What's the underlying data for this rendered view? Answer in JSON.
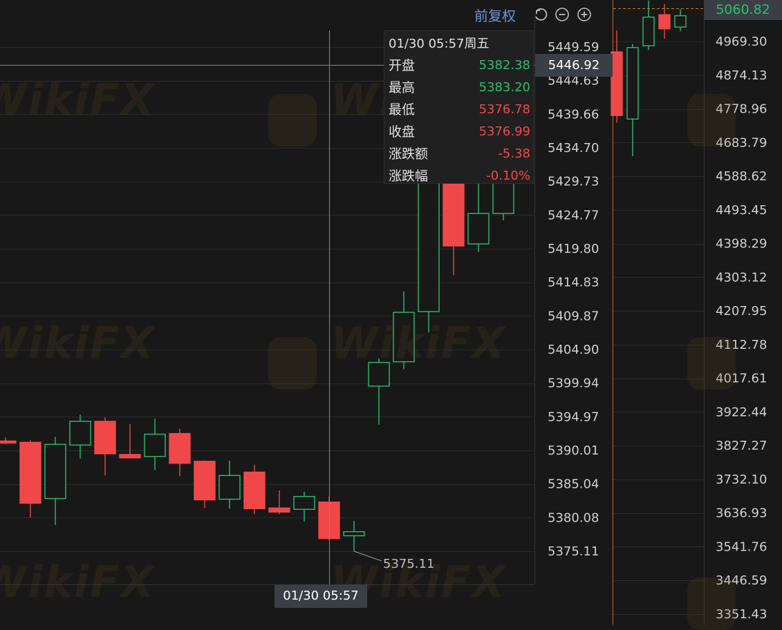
{
  "toolbar": {
    "adjust_label": "前复权",
    "icons": [
      "undo-icon",
      "zoom-out-icon",
      "zoom-in-icon"
    ]
  },
  "watermark": {
    "text": "WikiFX"
  },
  "colors": {
    "up": "#2dbd6e",
    "down": "#f04848",
    "background": "#181818",
    "grid": "#2a2a2a",
    "axis_text": "#d0d0d0"
  },
  "tooltip": {
    "date": "01/30 05:57周五",
    "rows": [
      {
        "key": "开盘",
        "value": "5382.38",
        "tone": "green"
      },
      {
        "key": "最高",
        "value": "5383.20",
        "tone": "green"
      },
      {
        "key": "最低",
        "value": "5376.78",
        "tone": "red"
      },
      {
        "key": "收盘",
        "value": "5376.99",
        "tone": "red"
      },
      {
        "key": "涨跌额",
        "value": "-5.38",
        "tone": "red"
      },
      {
        "key": "涨跌幅",
        "value": "-0.10%",
        "tone": "red"
      }
    ]
  },
  "crosshair": {
    "price_label": "5446.92",
    "time_label": "01/30 05:57"
  },
  "min_label": "5375.11",
  "right_panel": {
    "last_price": "5060.82"
  },
  "chart_data": [
    {
      "type": "candlestick",
      "title": "",
      "xlabel": "",
      "ylabel": "",
      "ylim": [
        5372.0,
        5458.0
      ],
      "y_ticks": [
        "5449.59",
        "5444.63",
        "5439.66",
        "5434.70",
        "5429.73",
        "5424.77",
        "5419.80",
        "5414.83",
        "5409.87",
        "5404.90",
        "5399.94",
        "5394.97",
        "5390.01",
        "5385.04",
        "5380.08",
        "5375.11"
      ],
      "grid": true,
      "candles": [
        {
          "o": 5391.4,
          "h": 5391.9,
          "l": 5390.9,
          "c": 5391.2
        },
        {
          "o": 5391.2,
          "h": 5391.5,
          "l": 5380.1,
          "c": 5382.2
        },
        {
          "o": 5382.9,
          "h": 5392.0,
          "l": 5379.0,
          "c": 5390.9
        },
        {
          "o": 5390.8,
          "h": 5395.3,
          "l": 5388.8,
          "c": 5394.3
        },
        {
          "o": 5394.3,
          "h": 5394.9,
          "l": 5386.3,
          "c": 5389.5
        },
        {
          "o": 5389.4,
          "h": 5393.9,
          "l": 5389.0,
          "c": 5388.9
        },
        {
          "o": 5389.1,
          "h": 5394.7,
          "l": 5387.1,
          "c": 5392.4
        },
        {
          "o": 5392.5,
          "h": 5393.2,
          "l": 5386.2,
          "c": 5388.1
        },
        {
          "o": 5388.4,
          "h": 5388.5,
          "l": 5381.5,
          "c": 5382.7
        },
        {
          "o": 5382.8,
          "h": 5388.5,
          "l": 5381.4,
          "c": 5386.3
        },
        {
          "o": 5386.8,
          "h": 5387.9,
          "l": 5380.6,
          "c": 5381.4
        },
        {
          "o": 5381.5,
          "h": 5384.1,
          "l": 5380.6,
          "c": 5380.9
        },
        {
          "o": 5381.3,
          "h": 5383.9,
          "l": 5379.5,
          "c": 5383.2
        },
        {
          "o": 5382.38,
          "h": 5383.2,
          "l": 5376.78,
          "c": 5376.99
        },
        {
          "o": 5377.4,
          "h": 5379.6,
          "l": 5375.11,
          "c": 5378.0
        },
        {
          "o": 5399.5,
          "h": 5403.6,
          "l": 5393.8,
          "c": 5403.0
        },
        {
          "o": 5403.1,
          "h": 5413.5,
          "l": 5402.0,
          "c": 5410.4
        },
        {
          "o": 5410.5,
          "h": 5442.0,
          "l": 5407.4,
          "c": 5441.5
        },
        {
          "o": 5436.0,
          "h": 5448.5,
          "l": 5415.9,
          "c": 5420.2
        },
        {
          "o": 5420.5,
          "h": 5433.0,
          "l": 5419.3,
          "c": 5425.0
        },
        {
          "o": 5425.0,
          "h": 5432.0,
          "l": 5424.0,
          "c": 5431.0
        }
      ]
    },
    {
      "type": "candlestick",
      "title": "",
      "xlabel": "",
      "ylabel": "",
      "ylim": [
        3320.0,
        5120.0
      ],
      "y_ticks": [
        "4969.30",
        "4874.13",
        "4778.96",
        "4683.79",
        "4588.62",
        "4493.45",
        "4398.29",
        "4303.12",
        "4207.95",
        "4112.78",
        "4017.61",
        "3922.44",
        "3827.27",
        "3732.10",
        "3636.93",
        "3541.76",
        "3446.59",
        "3351.43"
      ],
      "grid": true,
      "candles": [
        {
          "o": 4940.0,
          "h": 5000.0,
          "l": 4740.0,
          "c": 4760.0
        },
        {
          "o": 4750.0,
          "h": 4962.0,
          "l": 4645.0,
          "c": 4952.0
        },
        {
          "o": 4957.0,
          "h": 5085.0,
          "l": 4945.0,
          "c": 5038.0
        },
        {
          "o": 5045.0,
          "h": 5075.0,
          "l": 4977.0,
          "c": 5005.0
        },
        {
          "o": 5010.0,
          "h": 5060.0,
          "l": 4998.0,
          "c": 5042.0
        }
      ]
    }
  ]
}
